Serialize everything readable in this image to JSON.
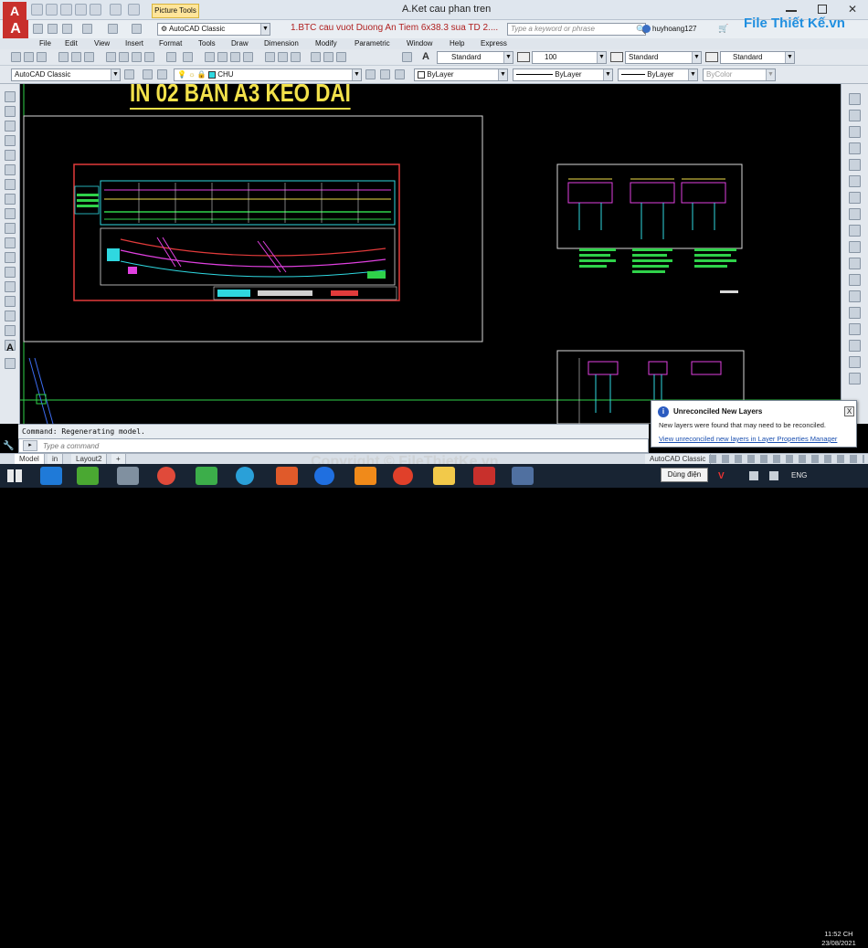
{
  "app": {
    "window_title": "A.Ket cau phan tren",
    "picture_tools": "Picture Tools",
    "workspace": "AutoCAD Classic",
    "document_tab": "1.BTC cau vuot Duong An Tiem 6x38.3 sua TD 2....",
    "search_placeholder": "Type a keyword or phrase",
    "user": "huyhoang127",
    "logo_text": "File Thiết Kế.vn"
  },
  "menu": [
    "File",
    "Edit",
    "View",
    "Insert",
    "Format",
    "Tools",
    "Draw",
    "Dimension",
    "Modify",
    "Parametric",
    "Window",
    "Help",
    "Express"
  ],
  "toolbar1": {
    "text_style": "Standard",
    "dim_scale": "100",
    "dim_style": "Standard",
    "table_style": "Standard"
  },
  "toolbar2": {
    "workspace": "AutoCAD Classic",
    "layer": "CHU",
    "color": "ByLayer",
    "linetype": "ByLayer",
    "lineweight": "ByLayer",
    "plot_style": "ByColor"
  },
  "drawing": {
    "banner_text": "IN 02 BẢN A3 KÉO DÀI"
  },
  "command": {
    "history": "Command: Regenerating model.",
    "placeholder": "Type a command"
  },
  "layout_tabs": [
    "Model",
    "in",
    "Layout2",
    "+"
  ],
  "status": {
    "workspace": "AutoCAD Classic"
  },
  "notification": {
    "title": "Unreconciled New Layers",
    "body": "New layers were found that may need to be reconciled.",
    "link": "View unreconciled new layers in Layer Properties Manager",
    "close": "X"
  },
  "taskbar": {
    "tooltip": "Dùng điện",
    "lang": "ENG",
    "time": "11:52 CH",
    "date": "23/08/2021"
  },
  "watermark": "Copyright © FileThietKe.vn",
  "colors": {
    "drawing_bg": "#000000",
    "banner": "#f2e14a",
    "frame_red": "#e23b3b",
    "line_green": "#2fd24a",
    "line_cyan": "#2fd8e0",
    "line_magenta": "#e040e0"
  }
}
